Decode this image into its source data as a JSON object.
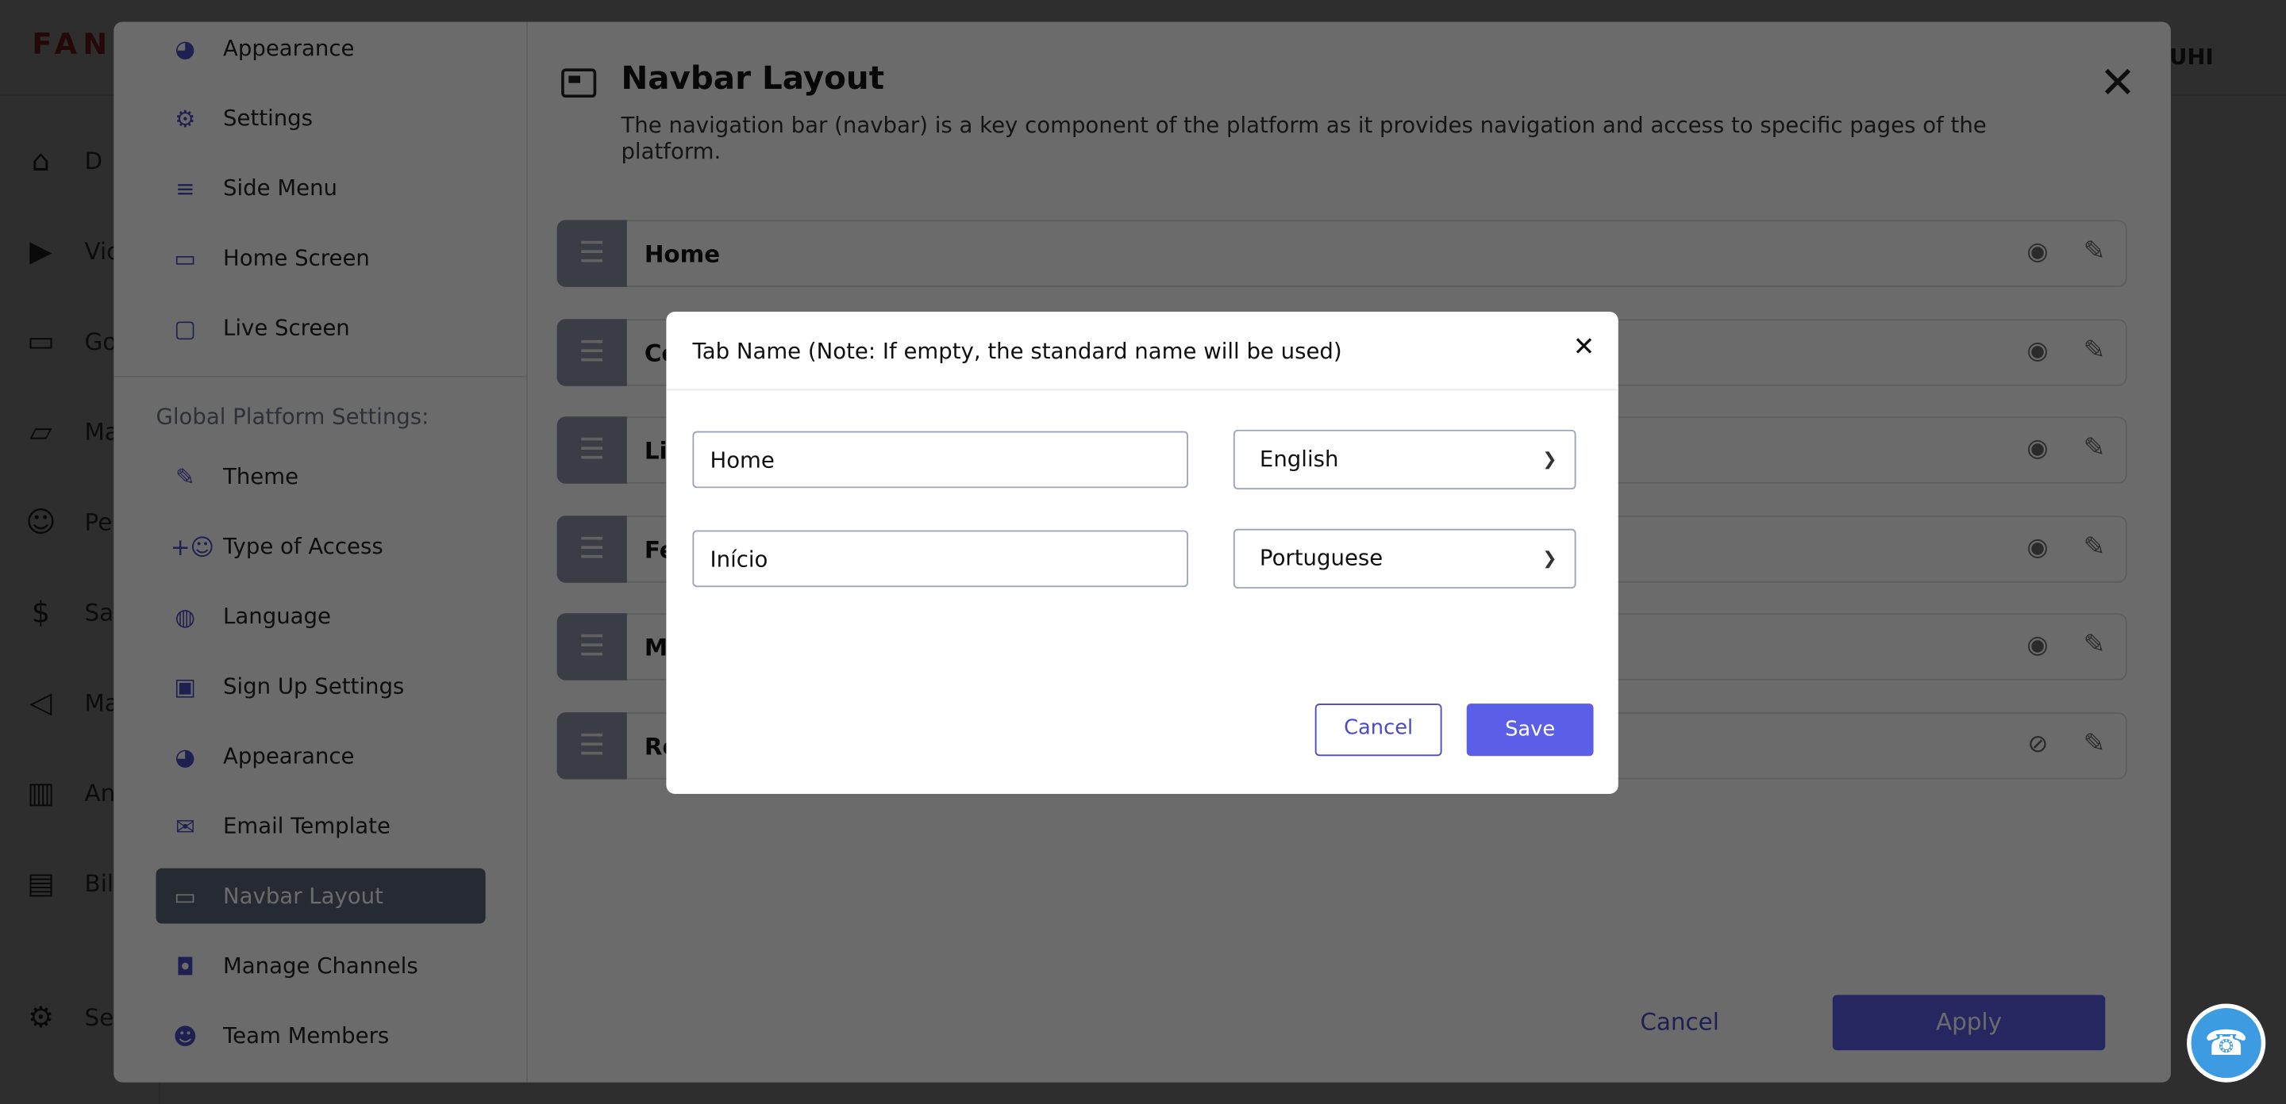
{
  "app": {
    "logo": "FAN",
    "user_partial": "UHI",
    "sidebar": [
      {
        "icon": "home-icon",
        "label": "D"
      },
      {
        "icon": "play-circle-icon",
        "label": "Vic"
      },
      {
        "icon": "tv-icon",
        "label": "Go"
      },
      {
        "icon": "folder-gear-icon",
        "label": "Ma"
      },
      {
        "icon": "people-icon",
        "label": "Pe"
      },
      {
        "icon": "dollar-icon",
        "label": "Sal"
      },
      {
        "icon": "megaphone-icon",
        "label": "Ma"
      },
      {
        "icon": "chart-icon",
        "label": "An"
      },
      {
        "icon": "invoice-icon",
        "label": "Bil"
      },
      {
        "icon": "gear-icon",
        "label": "Se"
      }
    ]
  },
  "modal": {
    "sidebar_top": [
      {
        "icon": "palette-icon",
        "label": "Appearance"
      },
      {
        "icon": "gear-icon",
        "label": "Settings"
      },
      {
        "icon": "list-play-icon",
        "label": "Side Menu"
      },
      {
        "icon": "video-icon",
        "label": "Home Screen"
      },
      {
        "icon": "screen-gear-icon",
        "label": "Live Screen"
      }
    ],
    "group_title": "Global Platform Settings:",
    "sidebar_global": [
      {
        "icon": "pencil-icon",
        "label": "Theme"
      },
      {
        "icon": "group-add-icon",
        "label": "Type of Access"
      },
      {
        "icon": "globe-icon",
        "label": "Language"
      },
      {
        "icon": "id-card-icon",
        "label": "Sign Up Settings"
      },
      {
        "icon": "palette-icon",
        "label": "Appearance"
      },
      {
        "icon": "mail-icon",
        "label": "Email Template"
      },
      {
        "icon": "navbar-icon",
        "label": "Navbar Layout",
        "active": true
      },
      {
        "icon": "cast-icon",
        "label": "Manage Channels"
      },
      {
        "icon": "team-icon",
        "label": "Team Members"
      }
    ],
    "title": "Navbar Layout",
    "description": "The navigation bar (navbar) is a key component of the platform as it provides navigation and access to specific pages of the platform.",
    "rows": [
      {
        "label": "Home",
        "visible": true
      },
      {
        "label": "Co",
        "visible": true
      },
      {
        "label": "Liv",
        "visible": true
      },
      {
        "label": "Fe",
        "visible": true
      },
      {
        "label": "My",
        "visible": true
      },
      {
        "label": "Ro",
        "visible": false
      }
    ],
    "cancel": "Cancel",
    "apply": "Apply"
  },
  "dialog": {
    "title": "Tab Name (Note: If empty, the standard name will be used)",
    "fields": [
      {
        "value": "Home",
        "language": "English"
      },
      {
        "value": "Início",
        "language": "Portuguese"
      }
    ],
    "cancel": "Cancel",
    "save": "Save"
  },
  "colors": {
    "accent": "#5b5ee6",
    "help": "#3d9be2"
  }
}
